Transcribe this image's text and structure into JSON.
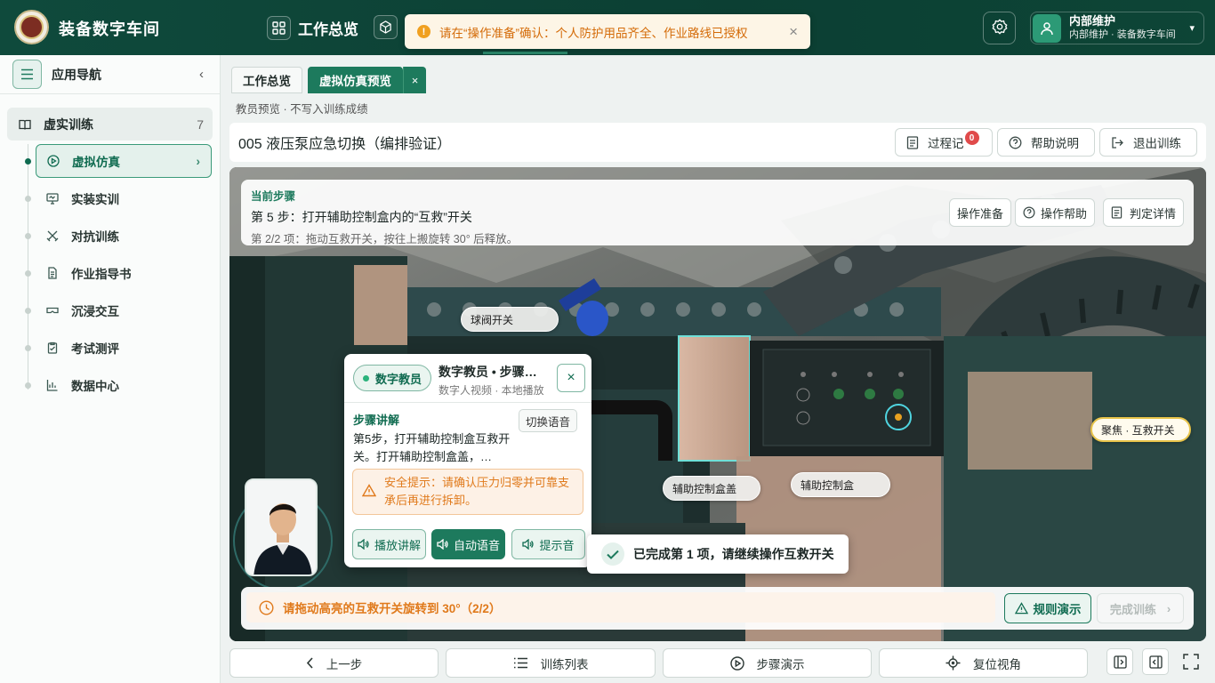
{
  "app": {
    "title": "装备数字车间"
  },
  "topnav": {
    "item1": "工作总览"
  },
  "toast": {
    "text": "请在“操作准备”确认：个人防护用品齐全、作业路线已授权",
    "icon": "exclamation-icon"
  },
  "user": {
    "name": "内部维护",
    "sub": "内部维护 · 装备数字车间"
  },
  "sidebar": {
    "title": "应用导航",
    "group": {
      "label": "虚实训练",
      "count": "7"
    },
    "items": [
      {
        "label": "虚拟仿真",
        "icon": "play-circle-icon",
        "active": true
      },
      {
        "label": "实装实训",
        "icon": "monitor-icon"
      },
      {
        "label": "对抗训练",
        "icon": "swords-icon"
      },
      {
        "label": "作业指导书",
        "icon": "document-icon"
      },
      {
        "label": "沉浸交互",
        "icon": "vr-goggles-icon"
      },
      {
        "label": "考试测评",
        "icon": "clipboard-icon"
      },
      {
        "label": "数据中心",
        "icon": "chart-icon"
      }
    ]
  },
  "tabs": [
    {
      "label": "工作总览"
    },
    {
      "label": "虚拟仿真预览"
    }
  ],
  "subnote": "教员预览 · 不写入训练成绩",
  "page": {
    "title": "005 液压泵应急切换（编排验证）",
    "actions": {
      "log": "过程记",
      "log_badge": "0",
      "help": "帮助说明",
      "exit": "退出训练"
    }
  },
  "step": {
    "label": "当前步骤",
    "title": "第 5 步：打开辅助控制盒内的“互救”开关",
    "sub": "第 2/2 项：拖动互救开关，按往上搬旋转 30° 后释放。",
    "buttons": {
      "prep": "操作准备",
      "help": "操作帮助",
      "judge": "判定详情"
    }
  },
  "scene_labels": {
    "ball_valve": "球阀开关",
    "box_lid": "辅助控制盒盖",
    "box": "辅助控制盒",
    "focus": "聚焦 · 互救开关"
  },
  "tutor": {
    "tag": "数字教员",
    "name": "数字教员 • 步骤讲解",
    "sub": "数字人视频 · 本地播放",
    "heading": "步骤讲解",
    "switch_voice": "切换语音",
    "body": "第5步，打开辅助控制盒互救开关。打开辅助控制盒盖，…",
    "warning": "安全提示：请确认压力归零并可靠支承后再进行拆卸。",
    "btn_play": "播放讲解",
    "btn_auto": "自动语音",
    "btn_tone": "提示音"
  },
  "done_toast": "已完成第 1 项，请继续操作互救开关",
  "hint": {
    "text": "请拖动高亮的互救开关旋转到 30°（2/2）",
    "rule": "规则演示",
    "finish": "完成训练"
  },
  "bottom": {
    "prev": "上一步",
    "list": "训练列表",
    "demo": "步骤演示",
    "reset": "复位视角"
  },
  "colors": {
    "brand": "#0f4a3c",
    "accent": "#1d7a5d",
    "warn": "#e07a1c",
    "danger": "#e04b4b"
  }
}
